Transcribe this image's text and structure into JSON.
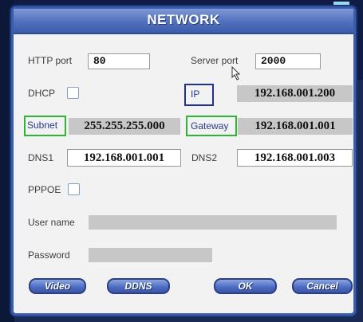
{
  "dialog": {
    "title": "NETWORK"
  },
  "fields": {
    "http_port": {
      "label": "HTTP port",
      "value": "80"
    },
    "server_port": {
      "label": "Server port",
      "value": "2000"
    },
    "dhcp": {
      "label": "DHCP",
      "checked": false
    },
    "ip": {
      "label": "IP",
      "value": "192.168.001.200"
    },
    "subnet": {
      "label": "Subnet",
      "value": "255.255.255.000"
    },
    "gateway": {
      "label": "Gateway",
      "value": "192.168.001.001"
    },
    "dns1": {
      "label": "DNS1",
      "value": "192.168.001.001"
    },
    "dns2": {
      "label": "DNS2",
      "value": "192.168.001.003"
    },
    "pppoe": {
      "label": "PPPOE",
      "checked": false
    },
    "user_name": {
      "label": "User name",
      "value": ""
    },
    "password": {
      "label": "Password",
      "value": ""
    }
  },
  "buttons": {
    "video": "Video",
    "ddns": "DDNS",
    "ok": "OK",
    "cancel": "Cancel"
  },
  "colors": {
    "highlight_green": "#2fb534",
    "highlight_blue": "#22318f",
    "button_blue": "#4a6ac0"
  }
}
